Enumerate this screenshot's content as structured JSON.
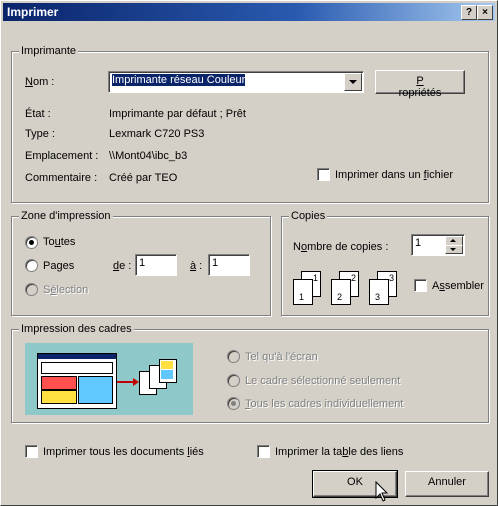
{
  "title": "Imprimer",
  "titlebar_buttons": {
    "help": "?",
    "close": "×"
  },
  "printer": {
    "group_label": "Imprimante",
    "name_label": "Nom :",
    "name_value": "Imprimante  réseau Couleur",
    "properties_button": "Propriétés",
    "status_label": "État :",
    "status_value": "Imprimante par défaut ; Prêt",
    "type_label": "Type :",
    "type_value": "Lexmark C720 PS3",
    "location_label": "Emplacement :",
    "location_value": "\\\\Mont04\\ibc_b3",
    "comment_label": "Commentaire :",
    "comment_value": "Créé par TEO",
    "print_to_file_label": "Imprimer dans un fichier",
    "print_to_file_checked": false
  },
  "print_range": {
    "group_label": "Zone d'impression",
    "all_label": "Toutes",
    "pages_label": "Pages",
    "from_label": "de :",
    "from_value": "1",
    "to_label": "à :",
    "to_value": "1",
    "selection_label": "Sélection",
    "selected": "all"
  },
  "copies": {
    "group_label": "Copies",
    "count_label": "Nombre de copies :",
    "count_value": "1",
    "collate_label": "Assembler",
    "collate_checked": false,
    "illustration": [
      "1",
      "1",
      "2",
      "2",
      "3",
      "3"
    ]
  },
  "frames": {
    "group_label": "Impression des cadres",
    "options": [
      "Tel qu'à l'écran",
      "Le cadre sélectionné seulement",
      "Tous les cadres individuellement"
    ],
    "selected_index": 2,
    "disabled": true
  },
  "bottom": {
    "print_linked_docs": "Imprimer tous les documents liés",
    "print_link_table": "Imprimer la table des liens",
    "ok": "OK",
    "cancel": "Annuler"
  }
}
